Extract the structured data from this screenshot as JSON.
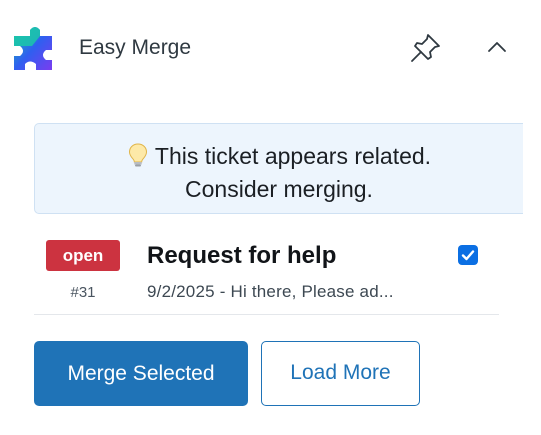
{
  "app": {
    "title": "Easy Merge",
    "logo_icon": "puzzle-piece-logo",
    "pin_icon": "pin-icon",
    "collapse_icon": "chevron-up-icon"
  },
  "notice": {
    "icon": "lightbulb-icon",
    "line1": "This ticket appears related.",
    "line2": "Consider merging."
  },
  "tickets": [
    {
      "status": "open",
      "status_color": "#cc3340",
      "id": "#31",
      "title": "Request for help",
      "subtitle": "9/2/2025 - Hi there, Please ad...",
      "selected": true
    }
  ],
  "actions": {
    "merge_label": "Merge Selected",
    "load_more_label": "Load More"
  },
  "colors": {
    "accent": "#1f73b7",
    "notice_bg": "#edf5fd",
    "checkbox": "#0b6fe3"
  }
}
